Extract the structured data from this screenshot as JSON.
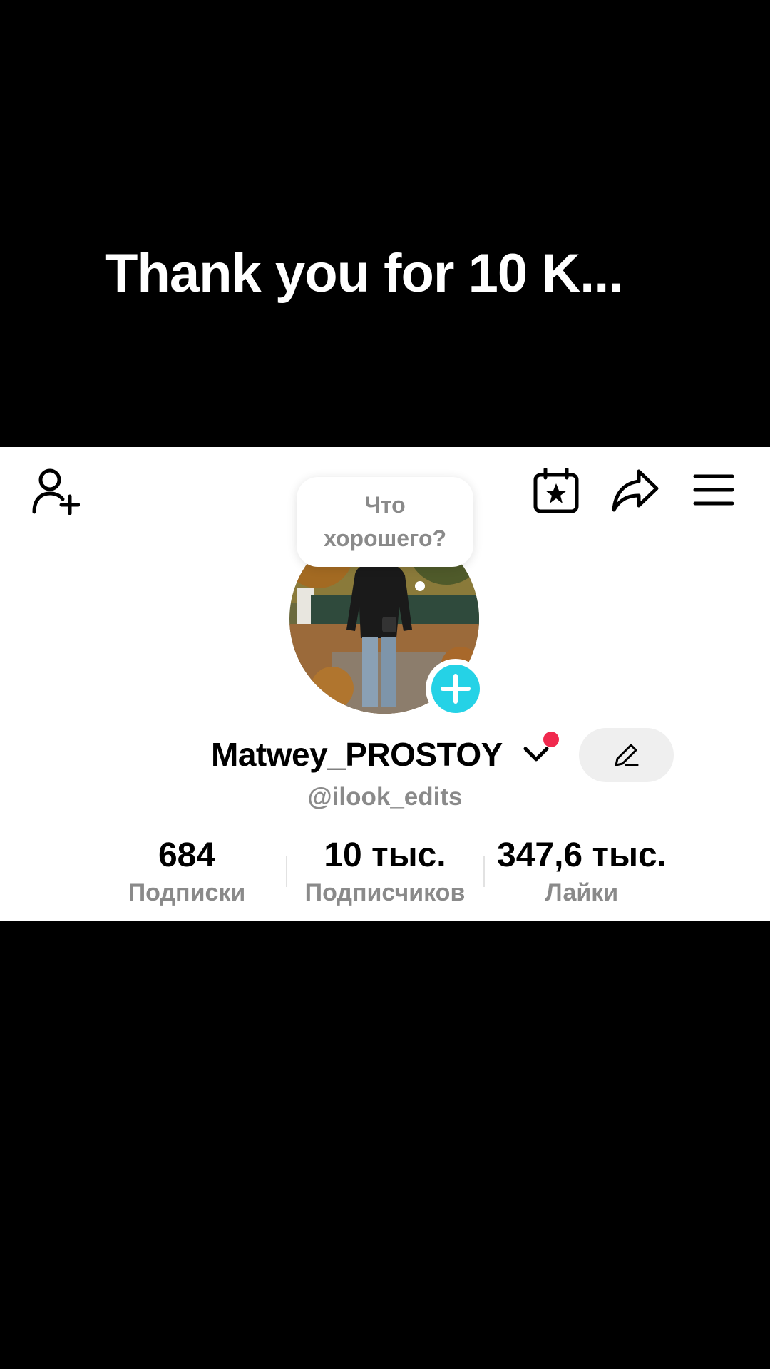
{
  "video_caption": "Thank you for 10 K...",
  "profile": {
    "status_bubble": "Что хорошего?",
    "username": "Matwey_PROSTOY",
    "handle": "@ilook_edits"
  },
  "stats": [
    {
      "value": "684",
      "label": "Подписки"
    },
    {
      "value": "10 тыс.",
      "label": "Подписчиков"
    },
    {
      "value": "347,6 тыс.",
      "label": "Лайки"
    }
  ],
  "icons": {
    "top_left": "add-friend-icon",
    "top_right": [
      "calendar-star-icon",
      "share-icon",
      "menu-icon"
    ],
    "username_dropdown": "chevron-down-icon",
    "edit": "pencil-icon",
    "avatar_badge": "plus-icon"
  },
  "colors": {
    "background": "#000000",
    "card": "#ffffff",
    "accent_add": "#25d2e6",
    "notification_dot": "#f0294e",
    "muted_text": "#8a8a8a"
  }
}
